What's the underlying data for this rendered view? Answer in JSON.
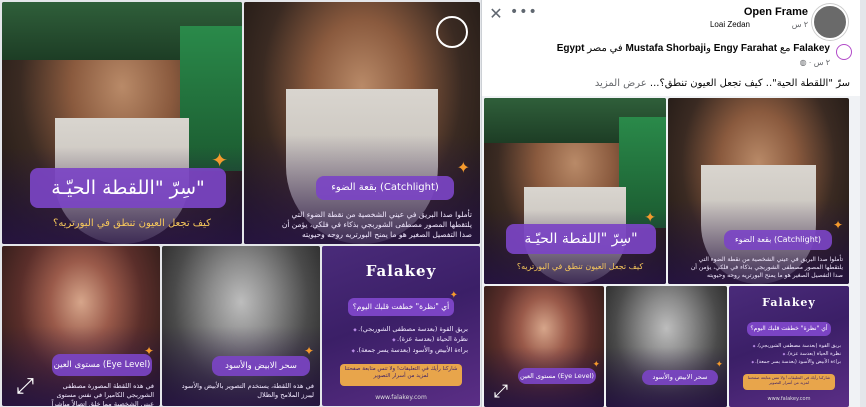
{
  "gallery": {
    "tile1": {
      "banner_title": "سِرّ \"اللقطة الحيّـة\"",
      "subline": "كيف تجعل العيون تنطق في البورتريه؟"
    },
    "tile2": {
      "banner_title": "بقعة الضوء (Catchlight)",
      "body": "تأملوا صدا البريق في عيني الشخصية من نقطة الضوء التي يلتقطها المصور مصطفى الشوربجي بذكاء في فلكي، يؤمن أن صدا التفصيل الصغير هو ما يمنح البورتريه روحه وحيويته"
    },
    "tile3": {
      "banner_title": "مستوى العين (Eye Level)",
      "body": "في هذه اللقطة المصورة مصطفى الشوربجي الكاميرا في نفس مستوى عيني الشخصية مما خلق اتصالاً مباشراً"
    },
    "tile4": {
      "banner_title": "سحر الابيض والأسود",
      "body": "في هذه اللقطة، يستخدم التصوير بالأبيض والأسود ليبرز الملامح والظلال"
    },
    "tile5": {
      "brand": "Falakey",
      "question": "أي \"نظرة\" خطفت قلبك اليوم؟",
      "options": [
        "بريق القوة (بعدسة مصطفى الشوربجي).",
        "نظرة الحياة (بعدسة عزة).",
        "براءة الأبيض والأسود (بعدسة يسر جمعة)."
      ],
      "cta": "شاركنا رأيك في التعليقات! ولا تنس متابعة صفحتنا لمزيد من أسرار التصوير",
      "site": "www.falakey.com"
    }
  },
  "preview": {
    "frame_title": "Open Frame",
    "frame_time": "٢ س",
    "frame_author": "Loai Zedan",
    "close_icon": "close-icon",
    "more_icon": "more-icon",
    "post": {
      "page_name": "Falakey",
      "with_word": "مع",
      "person1": "Engy Farahat",
      "and_word": "و",
      "person2": "Mustafa Shorbaji",
      "in_word": "في",
      "location_word": "مصر",
      "location": "Egypt",
      "time": "٢ س",
      "caption": "سرّ \"اللقطة الحية\".. كيف تجعل العيون تنطق؟...",
      "see_more": "عرض المزيد"
    }
  },
  "colors": {
    "purple_banner": "#7b44c4",
    "accent_orange": "#f59a2d",
    "subline_gold": "#f6c75b"
  }
}
